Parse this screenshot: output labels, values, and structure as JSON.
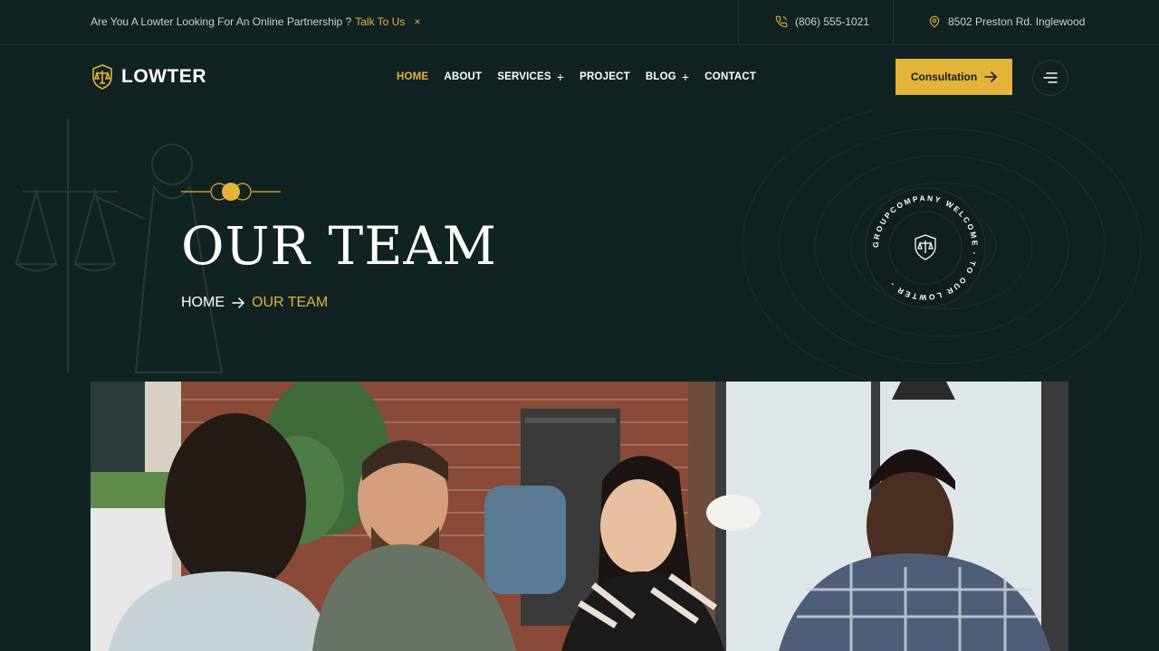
{
  "topbar": {
    "promo_text": "Are You A Lowter Looking For An Online Partnership ?",
    "promo_link": "Talk To Us",
    "close_symbol": "×",
    "phone": "(806) 555-1021",
    "phone_icon": "phone-icon",
    "address": "8502 Preston Rd. Inglewood",
    "address_icon": "map-pin-icon"
  },
  "header": {
    "logo_text": "LOWTER",
    "logo_icon": "shield-scales-icon",
    "nav": [
      {
        "label": "HOME",
        "active": true
      },
      {
        "label": "ABOUT"
      },
      {
        "label": "SERVICES",
        "dropdown": true
      },
      {
        "label": "PROJECT"
      },
      {
        "label": "BLOG",
        "dropdown": true
      },
      {
        "label": "CONTACT"
      }
    ],
    "cta_label": "Consultation",
    "menu_icon": "hamburger-icon"
  },
  "hero": {
    "title": "OUR TEAM",
    "breadcrumb_home": "HOME",
    "breadcrumb_current": "OUR TEAM",
    "badge_text": "GROUPCOMPANY WELCOME - TO OUR LOWTER - "
  },
  "colors": {
    "background": "#112222",
    "accent": "#e4b33a",
    "text": "#ffffff"
  }
}
